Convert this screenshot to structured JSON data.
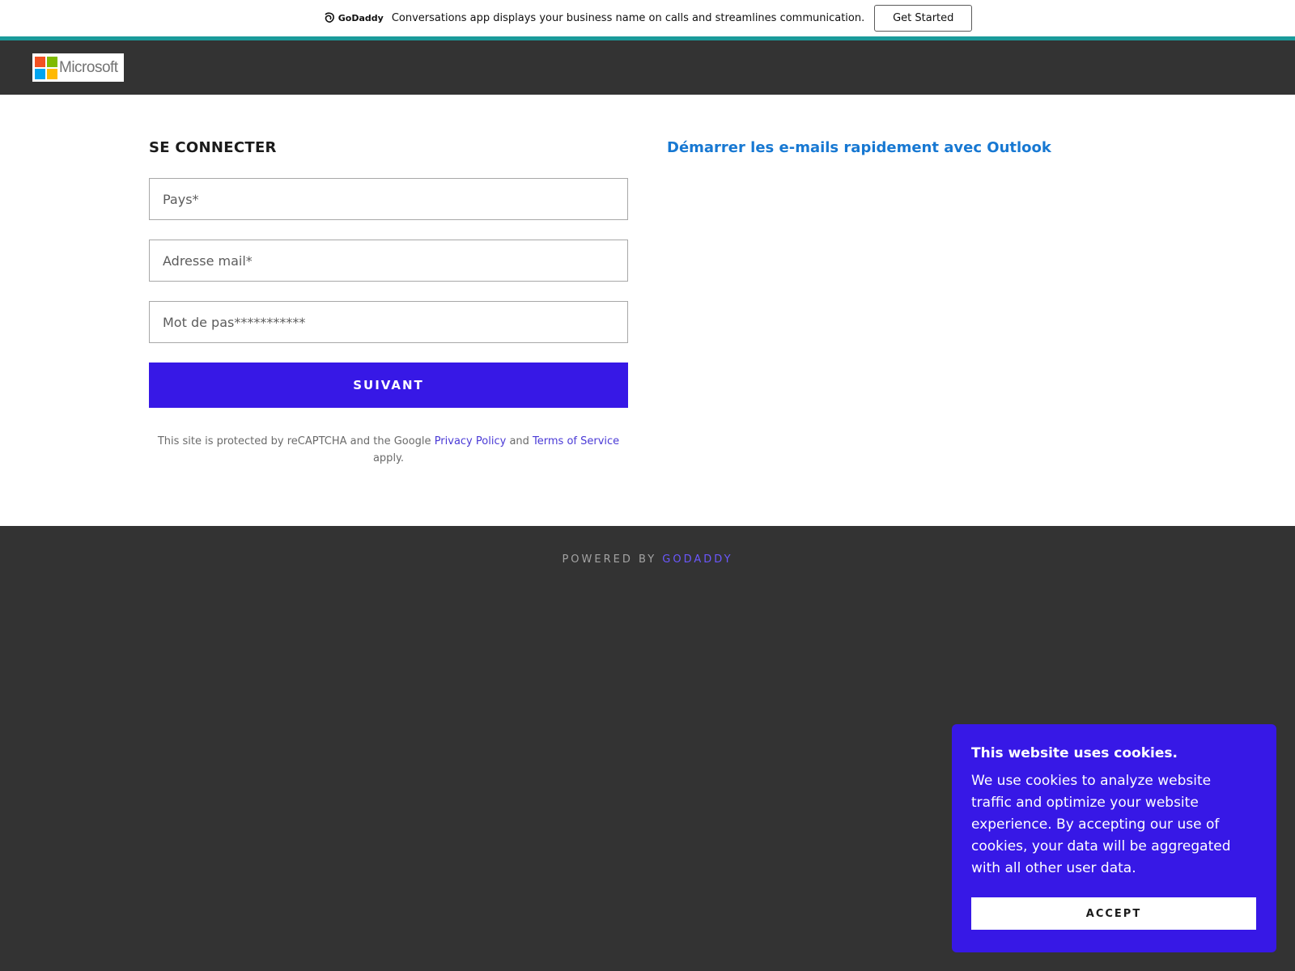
{
  "promo": {
    "brand": "GoDaddy",
    "text": "Conversations app displays your business name on calls and streamlines communication.",
    "cta": "Get Started"
  },
  "header": {
    "logo_text": "Microsoft"
  },
  "login": {
    "heading": "SE CONNECTER",
    "country_placeholder": "Pays*",
    "email_placeholder": "Adresse mail*",
    "password_placeholder": "Mot de pas***********",
    "submit_label": "SUIVANT",
    "recaptcha_prefix": "This site is protected by reCAPTCHA and the Google",
    "privacy_link": "Privacy Policy",
    "recaptcha_and": "and",
    "terms_link": "Terms of Service",
    "recaptcha_suffix": "apply."
  },
  "side": {
    "outlook_link": "Démarrer les e-mails rapidement avec Outlook"
  },
  "footer": {
    "powered_by": "POWERED BY",
    "powered_link": "GODADDY"
  },
  "cookie": {
    "title": "This website uses cookies.",
    "body": "We use cookies to analyze website traffic and optimize your website experience. By accepting our use of cookies, your data will be aggregated with all other user data.",
    "accept": "ACCEPT"
  },
  "colors": {
    "accent": "#3718e6",
    "link_blue": "#1778d2",
    "dark_bg": "#333333",
    "teal_stripe": "#1a9a9a"
  }
}
